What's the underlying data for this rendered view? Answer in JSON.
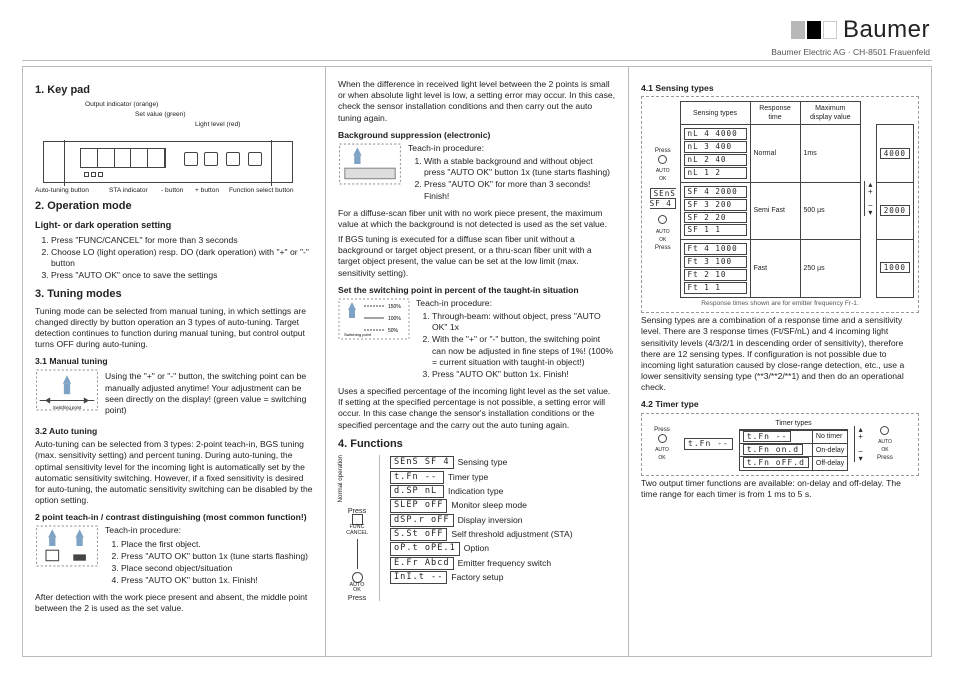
{
  "brand": {
    "name": "Baumer",
    "sub": "Baumer Electric AG · CH-8501 Frauenfeld",
    "stripes": [
      "#b8b8b8",
      "#000000",
      "#ffffff"
    ]
  },
  "col1": {
    "sec1": "1. Key pad",
    "keypad_callouts": {
      "out_ind": "Output indicator (orange)",
      "set_val": "Set value (green)",
      "light_lvl": "Light level (red)",
      "auto_tune": "Auto-tuning button",
      "sta_ind": "STA indicator",
      "dec_btn": "- button",
      "inc_btn": "+ button",
      "func_btn": "Function select button"
    },
    "sec2": "2. Operation mode",
    "sec2_sub": "Light- or dark operation setting",
    "sec2_list": [
      "Press \"FUNC/CANCEL\" for more than 3 seconds",
      "Choose LO (light operation) resp. DO (dark operation) with \"+\" or \"-\" button",
      "Press \"AUTO OK\" once to save the settings"
    ],
    "sec3": "3. Tuning modes",
    "sec3_p": "Tuning mode can be selected from manual tuning, in which settings are changed directly by button operation an 3 types of auto-tuning. Target detection continues to function during manual tuning, but control output turns OFF during auto-tuning.",
    "sec31": "3.1 Manual tuning",
    "sec31_fig_lbl": "Switching point",
    "sec31_p": "Using the \"+\" or \"-\" button, the switching point can be manually adjusted anytime! Your adjustment can be seen directly on the display! (green value = switching point)",
    "sec32": "3.2 Auto tuning",
    "sec32_p": "Auto-tuning can be selected from 3 types: 2-point teach-in, BGS tuning (max. sensitivity setting) and percent tuning. During auto-tuning, the optimal sensitivity level for the incoming light is automatically set by the automatic sensitivity switching. However, if a fixed sensitivity is desired for auto-tuning, the automatic sensitivity switching can be disabled by the option setting.",
    "sec32_h": "2 point teach-in / contrast distinguishing (most common function!)",
    "sec32_list_lbl": "Teach-in procedure:",
    "sec32_list": [
      "Place the first object.",
      "Press \"AUTO OK\" button 1x (tune starts flashing)",
      "Place second object/situation",
      "Press \"AUTO OK\" button 1x. Finish!"
    ],
    "sec3_tail": "After detection with the work piece present and absent, the middle point between the 2 is used as the set value."
  },
  "col2": {
    "p1": "When the difference in received light level between the 2 points is small or when absolute light level is low, a setting error may occur. In this case, check the sensor installation conditions and then carry out the auto tuning again.",
    "h_bgs": "Background suppression (electronic)",
    "bgs_list_lbl": "Teach-in procedure:",
    "bgs_list": [
      "With a stable background and without object press \"AUTO OK\" button 1x (tune starts flashing)",
      "Press \"AUTO OK\" for more than 3 seconds! Finish!"
    ],
    "p2": "For a diffuse-scan fiber unit with no work piece present, the maximum value at which the background is not detected is used as the set value.",
    "p3": "If BGS tuning is executed for a diffuse scan fiber unit without a background or target object present, or a thru-scan fiber unit with a target object present, the value can be set at the low limit (max. sensitivity setting).",
    "h_pct": "Set the switching point in percent of the taught-in situation",
    "pct_levels": [
      "150%",
      "100%",
      "50%"
    ],
    "pct_list_lbl": "Teach-in procedure:",
    "pct_list": [
      "Through-beam: without object, press \"AUTO OK\" 1x",
      "With the \"+\" or \"-\" button, the switching point can now be adjusted in fine steps of 1%! (100% = current situation with taught-in object!)",
      "Press \"AUTO OK\" button 1x. Finish!"
    ],
    "p4": "Uses a specified percentage of the incoming light level as the set value. If setting at the specified percentage is not possible, a setting error will occur. In this case change the sensor's installation conditions or the specified percentage and the carry out the auto tuning again.",
    "sec4": "4. Functions",
    "norm_op": "Normal operation",
    "ctrl_labels": {
      "press": "Press",
      "func_cancel": "FUNC\nCANCEL",
      "auto_ok": "AUTO\nOK"
    },
    "fn_rows": [
      {
        "lcd": "SEnS SF 4",
        "label": "Sensing type"
      },
      {
        "lcd": "t.Fn  --",
        "label": "Timer type"
      },
      {
        "lcd": "d.SP  nL",
        "label": "Indication type"
      },
      {
        "lcd": "SLEP oFF",
        "label": "Monitor sleep mode"
      },
      {
        "lcd": "dSP.r oFF",
        "label": "Display inversion"
      },
      {
        "lcd": "S.St oFF",
        "label": "Self threshold adjustment (STA)"
      },
      {
        "lcd": "oP.t oPE.1",
        "label": "Option"
      },
      {
        "lcd": "E.Fr Abcd",
        "label": "Emitter frequency switch"
      },
      {
        "lcd": "InI.t  --",
        "label": "Factory setup"
      }
    ]
  },
  "col3": {
    "sec41": "4.1 Sensing types",
    "tbl_head": [
      "Sensing types",
      "Response time",
      "Maximum display value"
    ],
    "lcd_left": "SEnS SF 4",
    "rows": [
      {
        "lcds": [
          "nL 4 4000",
          "nL 3  400",
          "nL 2   40",
          "nL 1    2"
        ],
        "type": "Normal",
        "time": "1ms",
        "max": "4000"
      },
      {
        "lcds": [
          "SF 4 2000",
          "SF 3  200",
          "SF 2   20",
          "SF 1    1"
        ],
        "type": "Semi Fast",
        "time": "500 µs",
        "max": "2000"
      },
      {
        "lcds": [
          "Ft 4 1000",
          "Ft 3  100",
          "Ft 2   10",
          "Ft 1    1"
        ],
        "type": "Fast",
        "time": "250 µs",
        "max": "1000"
      }
    ],
    "ctrl_labels": {
      "press": "Press",
      "auto_ok": "AUTO\nOK"
    },
    "tbl_note": "Response times shown are for emitter frequency Fr-1.",
    "p1": "Sensing types are a combination of a response time and a sensitivity level. There are 3 response times (Ft/SF/nL) and 4 incoming light sensitivity levels (4/3/2/1 in descending order of sensitivity), therefore there are 12 sensing types. If configuration is not possible due to incoming light saturation caused by close-range detection, etc., use a lower sensitivity sensing type (**3/**2/**1) and then do an operational check.",
    "sec42": "4.2 Timer type",
    "timer_left": "t.Fn  --",
    "timer_hdr": "Timer types",
    "timer_rows": [
      {
        "lcd": "t.Fn  --",
        "lbl": "No timer"
      },
      {
        "lcd": "t.Fn on.d",
        "lbl": "On-delay"
      },
      {
        "lcd": "t.Fn oFF.d",
        "lbl": "Off-delay"
      }
    ],
    "p2": "Two output timer functions are available: on-delay and off-delay. The time range for each timer is from 1 ms to 5 s."
  }
}
